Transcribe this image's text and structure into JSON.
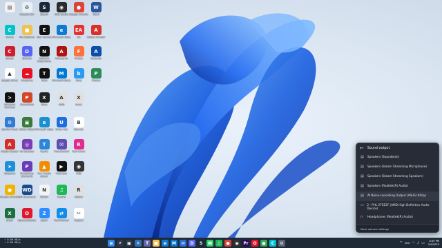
{
  "desktop": {
    "icons": [
      {
        "label": "",
        "color": "#f2f2f2",
        "glyph": "▤"
      },
      {
        "label": "Recycle Bin",
        "color": "#e7eef5",
        "glyph": "♻"
      },
      {
        "label": "Steam",
        "color": "#1b2838",
        "glyph": "S"
      },
      {
        "label": "OBS Studio",
        "color": "#2b2b2b",
        "glyph": "◉"
      },
      {
        "label": "Google Chrome",
        "color": "#db4437",
        "glyph": "●"
      },
      {
        "label": "Word",
        "color": "#2b579a",
        "glyph": "W"
      },
      {
        "label": "Canva",
        "color": "#00c4cc",
        "glyph": "C"
      },
      {
        "label": "File Explorer",
        "color": "#f2c14e",
        "glyph": "■"
      },
      {
        "label": "Epic Games",
        "color": "#111111",
        "glyph": "E"
      },
      {
        "label": "Microsoft Edge",
        "color": "#0f7ad1",
        "glyph": "e"
      },
      {
        "label": "EA",
        "color": "#e5322d",
        "glyph": "EA"
      },
      {
        "label": "Adobe Acrobat",
        "color": "#d9302a",
        "glyph": "A"
      },
      {
        "label": "Canon",
        "color": "#cf1f2e",
        "glyph": "C"
      },
      {
        "label": "Discord",
        "color": "#5865f2",
        "glyph": "D"
      },
      {
        "label": "GeForce Experience",
        "color": "#111111",
        "glyph": "N"
      },
      {
        "label": "Among Us",
        "color": "#b11212",
        "glyph": "A"
      },
      {
        "label": "Firefox",
        "color": "#ff7139",
        "glyph": "F"
      },
      {
        "label": "Audacity",
        "color": "#0f4ea8",
        "glyph": "A"
      },
      {
        "label": "Google Drive",
        "color": "#ffffff",
        "glyph": "▲"
      },
      {
        "label": "OneDrive",
        "color": "#e81123",
        "glyph": "☁"
      },
      {
        "label": "Tidal",
        "color": "#111111",
        "glyph": "T"
      },
      {
        "label": "Microsoft Store",
        "color": "#0078d4",
        "glyph": "M"
      },
      {
        "label": "Bing",
        "color": "#2b9af3",
        "glyph": "b"
      },
      {
        "label": "Photos",
        "color": "#2e8b57",
        "glyph": "P"
      },
      {
        "label": "Windows Terminal",
        "color": "#111111",
        "glyph": ">"
      },
      {
        "label": "PowerPoint",
        "color": "#d24726",
        "glyph": "P"
      },
      {
        "label": "Xbox",
        "color": "#222222",
        "glyph": "X"
      },
      {
        "label": "AMD",
        "color": "#e0e0e0",
        "glyph": "A"
      },
      {
        "label": "Excel",
        "color": "#e0e0e0",
        "glyph": "X"
      },
      {
        "label": "Control Panel",
        "color": "#2f7bd6",
        "glyph": "⚙"
      },
      {
        "label": "Sticky Notes",
        "color": "#3b7a3b",
        "glyph": "▣"
      },
      {
        "label": "Microsoft Edge",
        "color": "#1a8fd1",
        "glyph": "e"
      },
      {
        "label": "Unity Hub",
        "color": "#1f6ee0",
        "glyph": "U"
      },
      {
        "label": "Blender",
        "color": "#ffffff",
        "glyph": "B"
      },
      {
        "label": "Adobe Reader",
        "color": "#d62b2b",
        "glyph": "A"
      },
      {
        "label": "Tor Browser",
        "color": "#7a3fb5",
        "glyph": "◎"
      },
      {
        "label": "Teams",
        "color": "#2b86d9",
        "glyph": "T"
      },
      {
        "label": "Thunderbird",
        "color": "#5f4eb0",
        "glyph": "✉"
      },
      {
        "label": "Riot Client",
        "color": "#e12b8f",
        "glyph": "R"
      },
      {
        "label": "Telegram",
        "color": "#1e8fd8",
        "glyph": "➤"
      },
      {
        "label": "Photoshop Elements",
        "color": "#6a3db5",
        "glyph": "P"
      },
      {
        "label": "VLC media player",
        "color": "#f28c00",
        "glyph": "▲"
      },
      {
        "label": "Premiere",
        "color": "#111111",
        "glyph": "▶"
      },
      {
        "label": "OBS",
        "color": "#333333",
        "glyph": "◉"
      },
      {
        "label": "Google Chrome",
        "color": "#f1b300",
        "glyph": "●"
      },
      {
        "label": "WD Discovery",
        "color": "#1a4c8c",
        "glyph": "WD"
      },
      {
        "label": "Notion",
        "color": "#f4f4f4",
        "glyph": "N"
      },
      {
        "label": "Spotify",
        "color": "#1db954",
        "glyph": "♫"
      },
      {
        "label": "Roblox",
        "color": "#e0e0e0",
        "glyph": "R"
      },
      {
        "label": "Excel",
        "color": "#1d6f42",
        "glyph": "X"
      },
      {
        "label": "Opera Browser",
        "color": "#e0182d",
        "glyph": "O"
      },
      {
        "label": "Zoom",
        "color": "#2d8cff",
        "glyph": "Z"
      },
      {
        "label": "TeamViewer",
        "color": "#0e8ee9",
        "glyph": "⇄"
      },
      {
        "label": "CapCut",
        "color": "#ffffff",
        "glyph": "✂"
      }
    ]
  },
  "flyout": {
    "back_glyph": "←",
    "title": "Sound output",
    "devices": [
      {
        "name": "Speakers (Soundtech)",
        "icon": "speaker-icon"
      },
      {
        "name": "Speakers (Steam Streaming Microphone)",
        "icon": "speaker-icon"
      },
      {
        "name": "Speakers (Steam Streaming Speakers)",
        "icon": "speaker-icon"
      },
      {
        "name": "Speakers (Realtek(R) Audio)",
        "icon": "speaker-icon"
      },
      {
        "name": "AI Noise-cancelling Output (ASUS Utility)",
        "icon": "speaker-icon"
      },
      {
        "name": "2 - PHL 275E2F (AMD High Definition Audio Device)",
        "icon": "monitor-icon"
      },
      {
        "name": "Headphones (Realtek(R) Audio)",
        "icon": "headphones-icon"
      }
    ],
    "footer": "More volume settings"
  },
  "taskbar": {
    "net_up": "0.00 KB/s",
    "net_down": "0.00 KB/s",
    "apps": [
      {
        "name": "start",
        "color": "#2a86e8",
        "glyph": "⊞"
      },
      {
        "name": "search",
        "color": "#2a3744",
        "glyph": "⌕"
      },
      {
        "name": "task-view",
        "color": "#2a3744",
        "glyph": "▣"
      },
      {
        "name": "widgets",
        "color": "#3470b8",
        "glyph": "☀"
      },
      {
        "name": "chat",
        "color": "#6264a7",
        "glyph": "T"
      },
      {
        "name": "file-explorer",
        "color": "#f2c14e",
        "glyph": "■"
      },
      {
        "name": "edge",
        "color": "#0f7ad1",
        "glyph": "e"
      },
      {
        "name": "store",
        "color": "#0078d4",
        "glyph": "M"
      },
      {
        "name": "mail",
        "color": "#2b6fd6",
        "glyph": "✉"
      },
      {
        "name": "discord",
        "color": "#5865f2",
        "glyph": "D"
      },
      {
        "name": "steam",
        "color": "#1b2838",
        "glyph": "S"
      },
      {
        "name": "whatsapp",
        "color": "#25d366",
        "glyph": "☎"
      },
      {
        "name": "spotify",
        "color": "#1db954",
        "glyph": "♫"
      },
      {
        "name": "chrome",
        "color": "#db4437",
        "glyph": "●"
      },
      {
        "name": "obs",
        "color": "#333333",
        "glyph": "◉"
      },
      {
        "name": "premiere",
        "color": "#2a0a5a",
        "glyph": "Pr"
      },
      {
        "name": "opera",
        "color": "#e0182d",
        "glyph": "O"
      },
      {
        "name": "chrome2",
        "color": "#34a853",
        "glyph": "●"
      },
      {
        "name": "canva",
        "color": "#00c4cc",
        "glyph": "C"
      },
      {
        "name": "settings",
        "color": "#5a6472",
        "glyph": "⚙"
      }
    ],
    "tray_chevron": "^",
    "lang": "ENG",
    "wifi_glyph": "◠",
    "volume_glyph": "♪",
    "battery_glyph": "▭",
    "time": "8:39 PM",
    "date": "5/4/2023"
  }
}
